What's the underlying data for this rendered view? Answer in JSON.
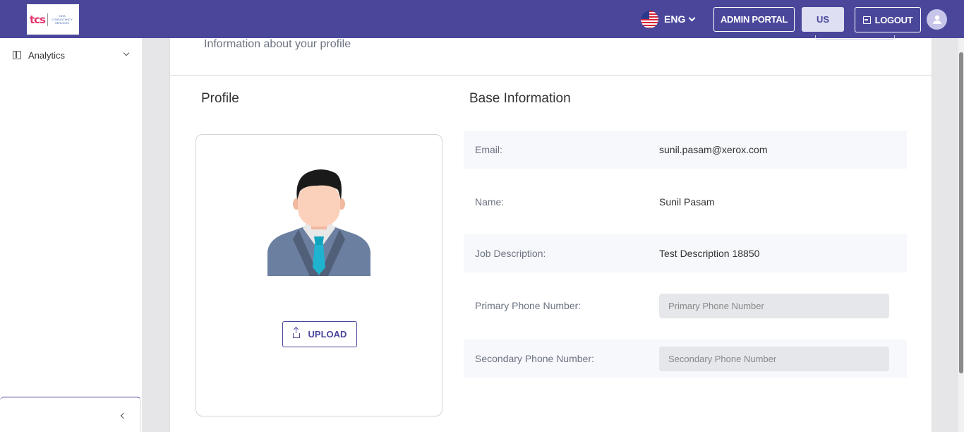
{
  "header": {
    "logo": {
      "brand": "tcs",
      "subtitle": "TATA CONSULTANCY SERVICES"
    },
    "language": "ENG",
    "admin_portal_label": "ADMIN PORTAL",
    "region_label": "US",
    "logout_label": "LOGOUT",
    "accent_color": "#4a479b"
  },
  "sidebar": {
    "items": [
      {
        "label": "Analytics",
        "icon": "book-icon"
      }
    ]
  },
  "page": {
    "subtitle": "Information about your profile"
  },
  "profile": {
    "heading": "Profile",
    "upload_label": "UPLOAD"
  },
  "base_info": {
    "heading": "Base Information",
    "email_label": "Email:",
    "email_value": "sunil.pasam@xerox.com",
    "name_label": "Name:",
    "name_value": "Sunil Pasam",
    "job_label": "Job Description:",
    "job_value": "Test Description 18850",
    "primary_phone_label": "Primary Phone Number:",
    "primary_phone_placeholder": "Primary Phone Number",
    "secondary_phone_label": "Secondary Phone Number:",
    "secondary_phone_placeholder": "Secondary Phone Number"
  }
}
